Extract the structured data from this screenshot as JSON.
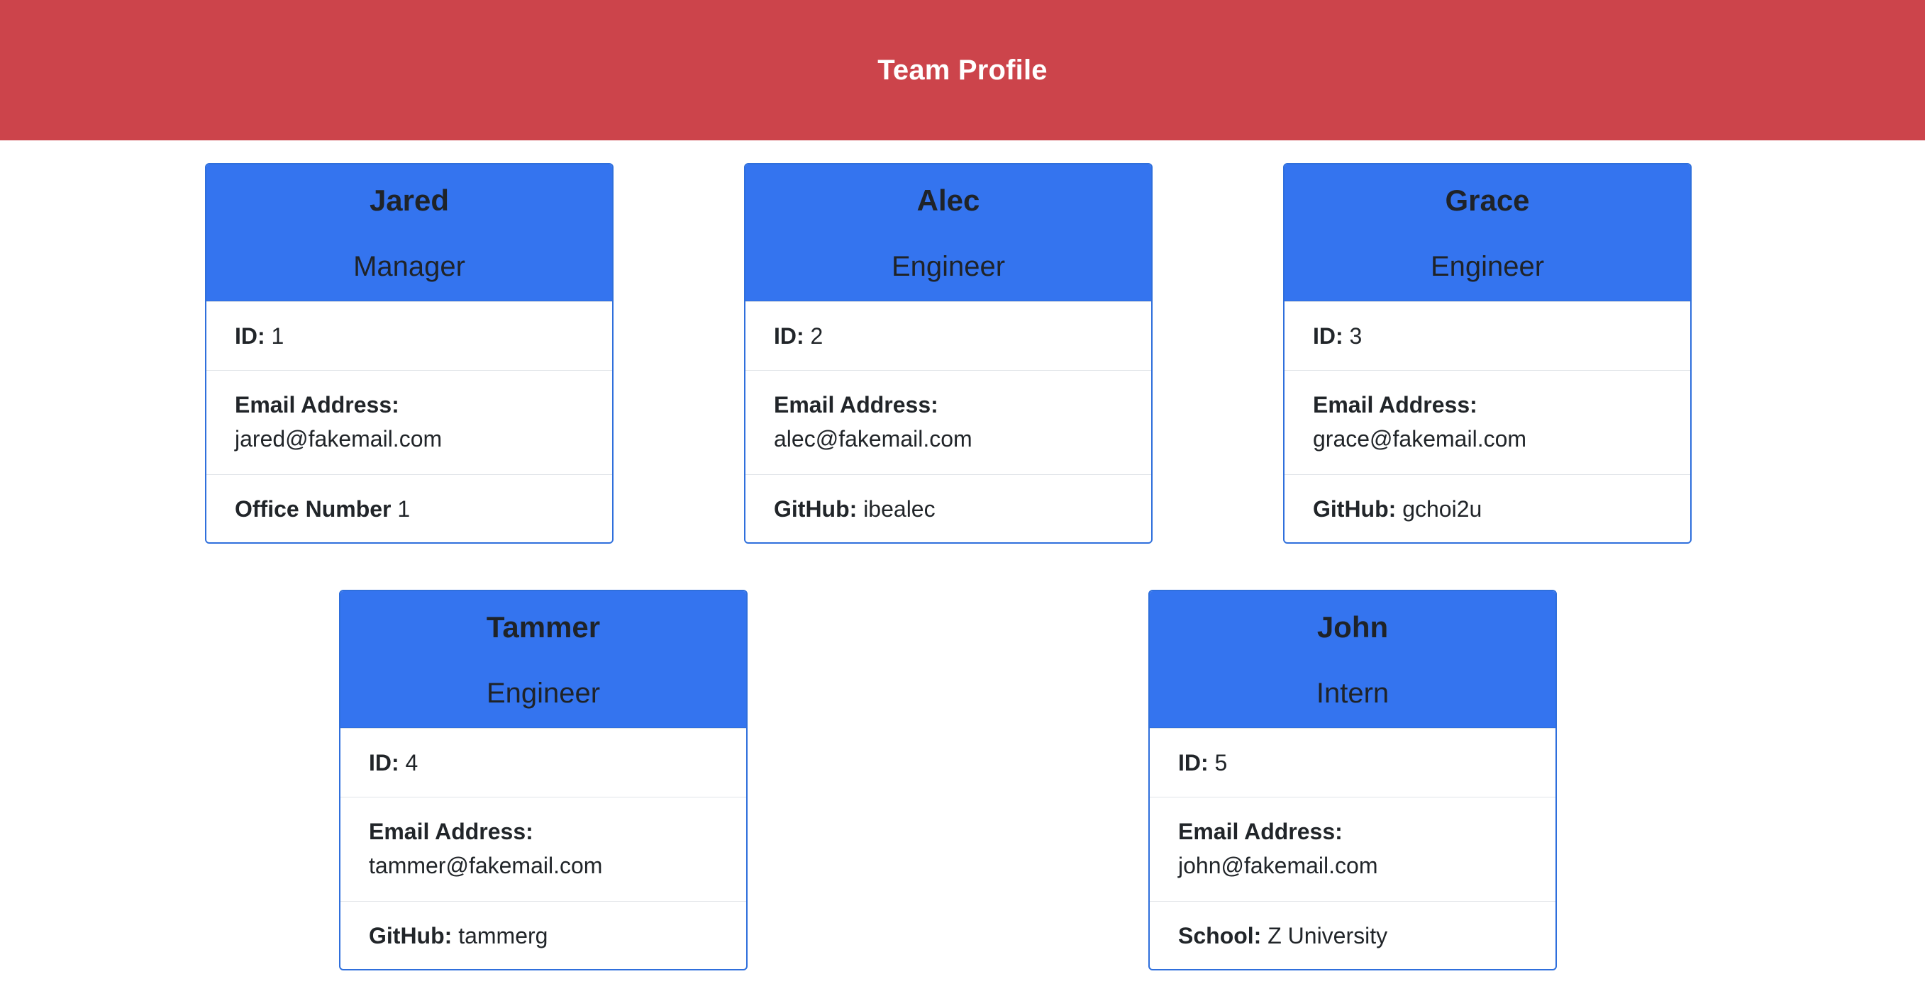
{
  "header": {
    "title": "Team Profile"
  },
  "employees": [
    {
      "name": "Jared",
      "role": "Manager",
      "id_label": "ID:",
      "id": "1",
      "email_label": "Email Address:",
      "email": "jared@fakemail.com",
      "extra_label": "Office Number",
      "extra": "1"
    },
    {
      "name": "Alec",
      "role": "Engineer",
      "id_label": "ID:",
      "id": "2",
      "email_label": "Email Address:",
      "email": "alec@fakemail.com",
      "extra_label": "GitHub:",
      "extra": "ibealec"
    },
    {
      "name": "Grace",
      "role": "Engineer",
      "id_label": "ID:",
      "id": "3",
      "email_label": "Email Address:",
      "email": "grace@fakemail.com",
      "extra_label": "GitHub:",
      "extra": "gchoi2u"
    },
    {
      "name": "Tammer",
      "role": "Engineer",
      "id_label": "ID:",
      "id": "4",
      "email_label": "Email Address:",
      "email": "tammer@fakemail.com",
      "extra_label": "GitHub:",
      "extra": "tammerg"
    },
    {
      "name": "John",
      "role": "Intern",
      "id_label": "ID:",
      "id": "5",
      "email_label": "Email Address:",
      "email": "john@fakemail.com",
      "extra_label": "School:",
      "extra": "Z University"
    }
  ],
  "colors": {
    "header_bg": "#cc444b",
    "card_header_bg": "#3474ef",
    "card_border": "#2f6fdc"
  }
}
